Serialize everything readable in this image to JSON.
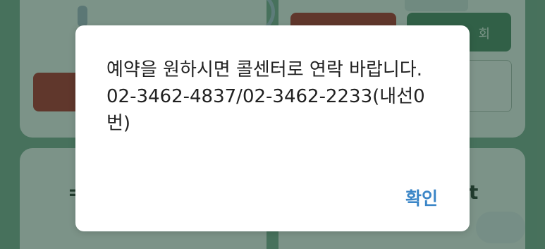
{
  "background": {
    "button_green_label": "회",
    "card_text_left": "=",
    "card_text_right": "t"
  },
  "dialog": {
    "message": "예약을 원하시면 콜센터로 연락 바랍니다. 02-3462-4837/02-3462-2233(내선0번)",
    "ok_label": "확인"
  },
  "colors": {
    "primary_text": "#212121",
    "ok_button": "#3b86c7",
    "background_green": "#6e9f86",
    "button_red": "#a5211c",
    "button_green": "#3d7a57"
  }
}
